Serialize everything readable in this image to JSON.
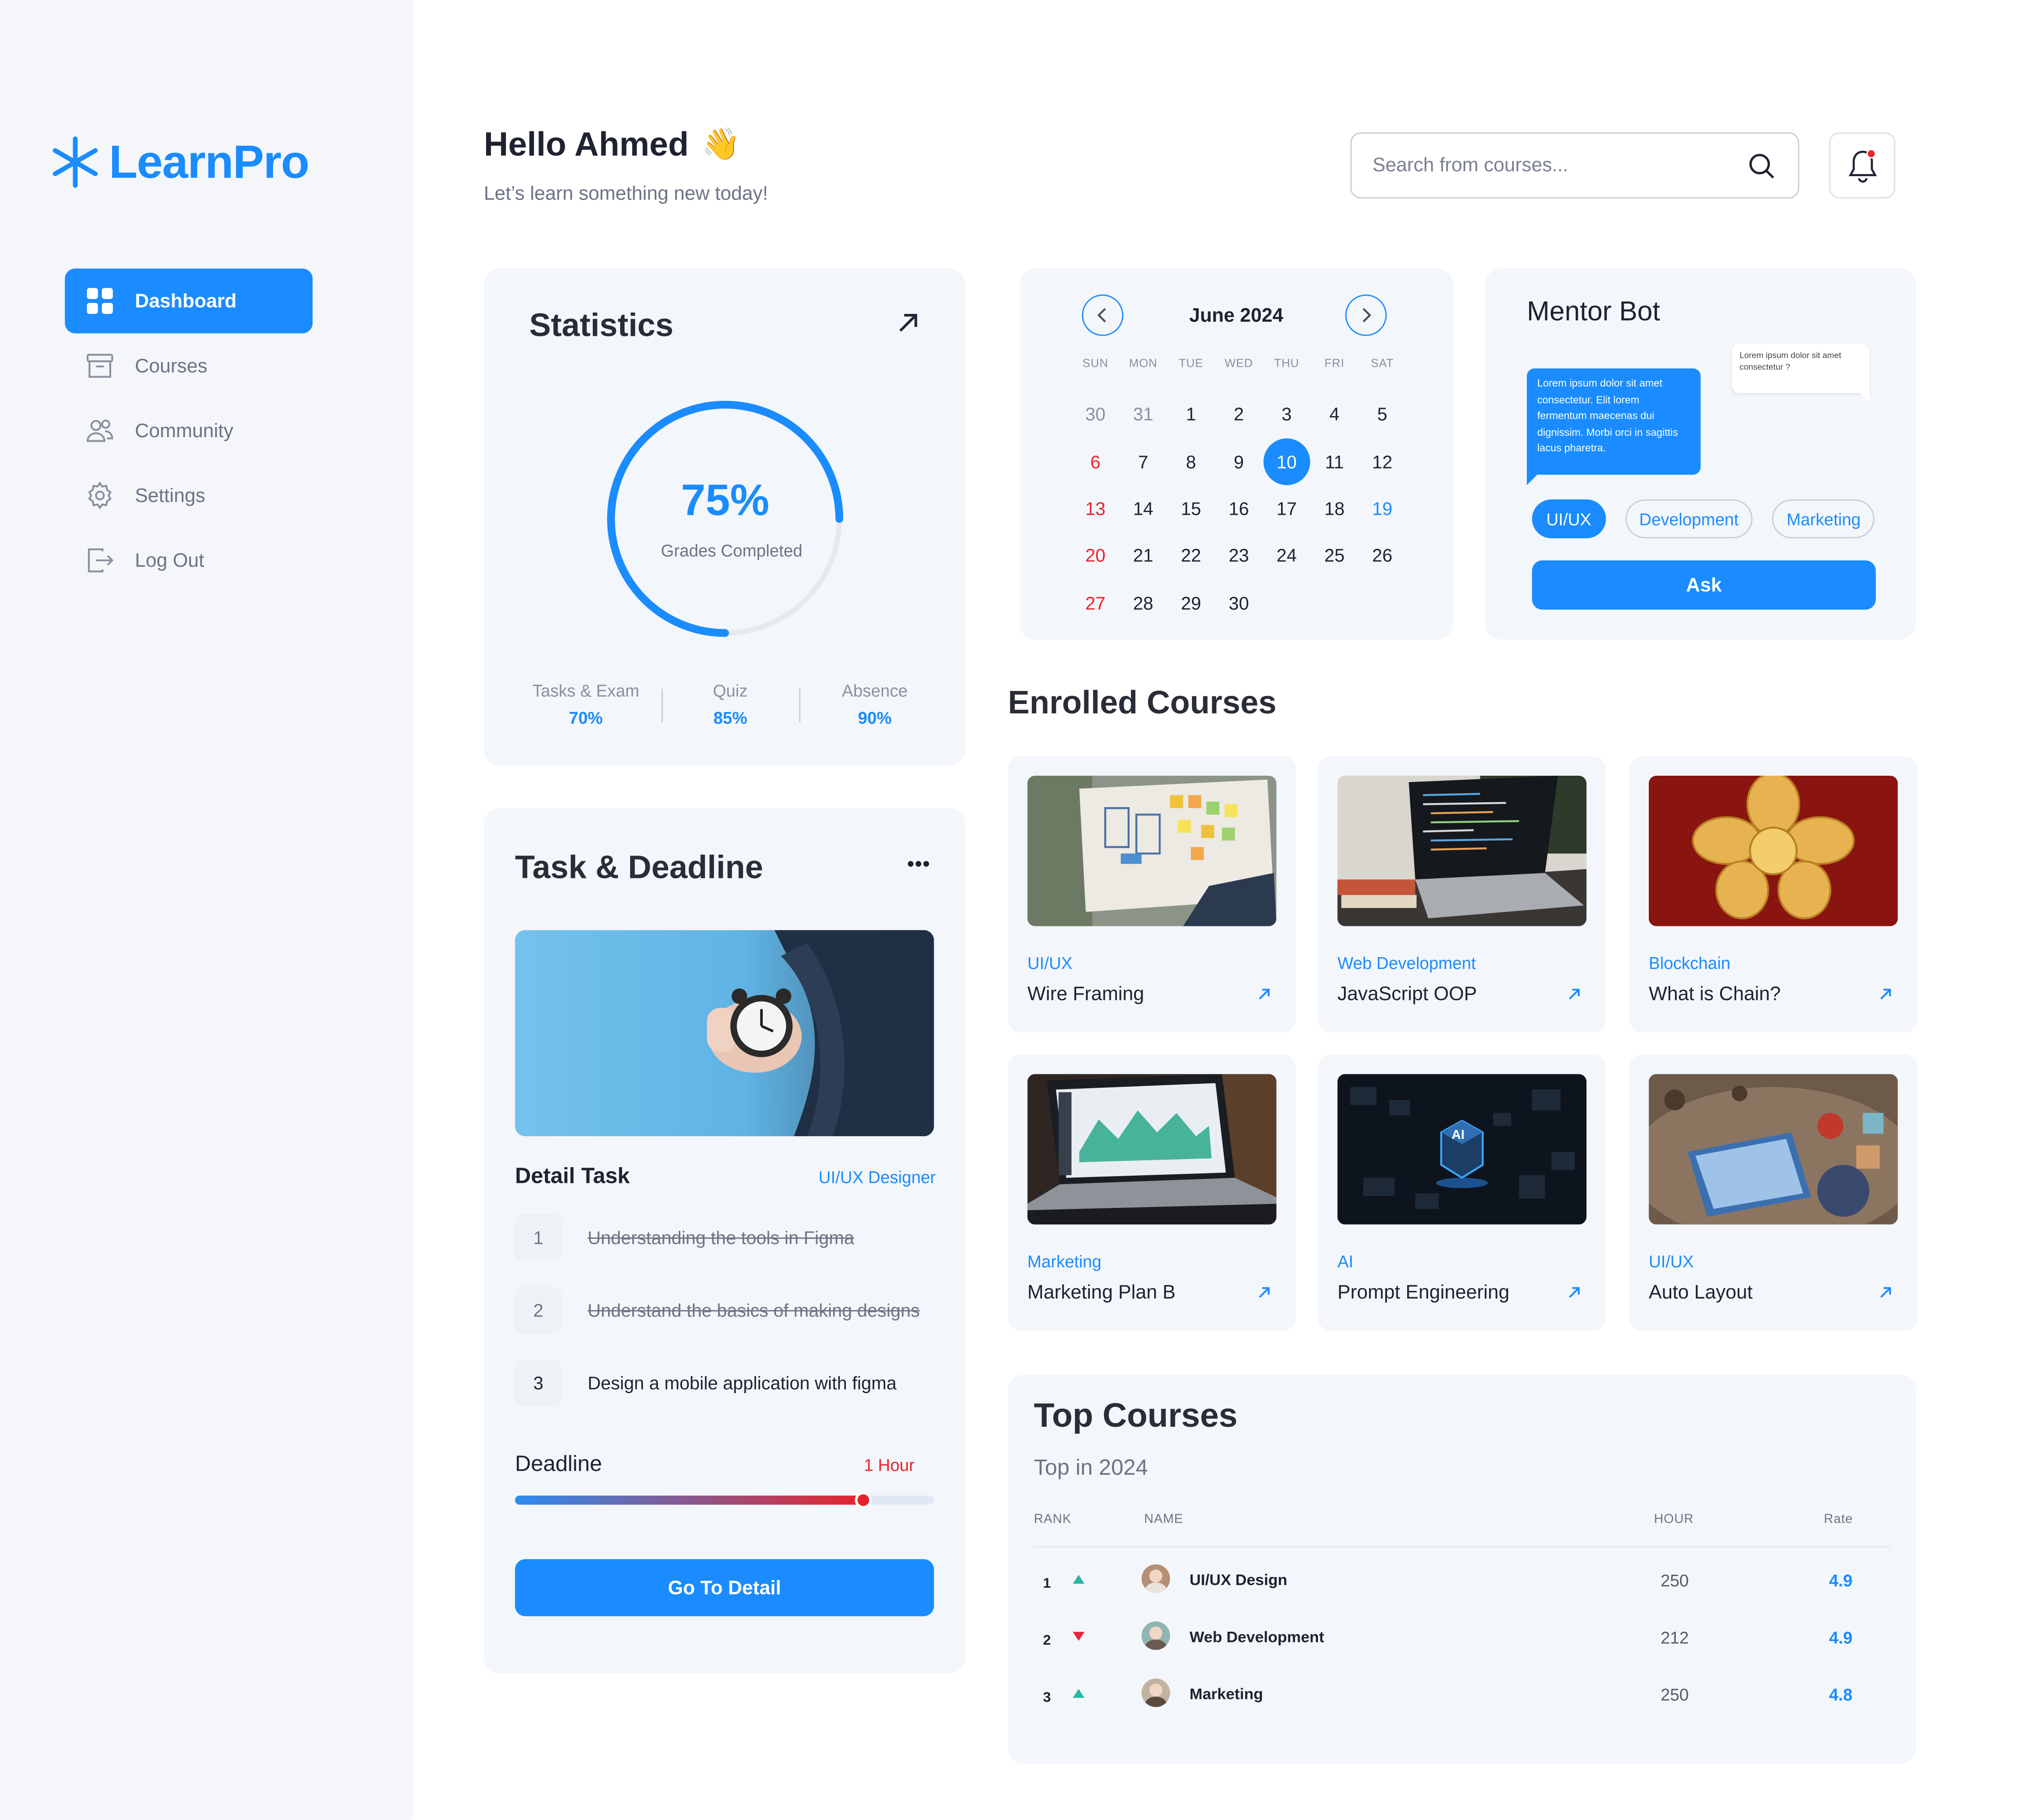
{
  "brand": {
    "name": "LearnPro",
    "color": "#1a8cff"
  },
  "sidebar": {
    "items": [
      {
        "label": "Dashboard",
        "icon": "grid-icon",
        "active": true
      },
      {
        "label": "Courses",
        "icon": "archive-icon",
        "active": false
      },
      {
        "label": "Community",
        "icon": "users-icon",
        "active": false
      },
      {
        "label": "Settings",
        "icon": "gear-icon",
        "active": false
      },
      {
        "label": "Log Out",
        "icon": "logout-icon",
        "active": false
      }
    ]
  },
  "header": {
    "greeting": "Hello Ahmed",
    "wave": "👋",
    "subtitle": "Let’s learn something new today!",
    "search_placeholder": "Search from courses...",
    "search_icon": "search-icon",
    "bell_icon": "bell-icon"
  },
  "statistics": {
    "title": "Statistics",
    "progress_label": "75%",
    "progress_fraction": 0.75,
    "progress_caption": "Grades Completed",
    "metrics": [
      {
        "label": "Tasks & Exam",
        "value": "70%"
      },
      {
        "label": "Quiz",
        "value": "85%"
      },
      {
        "label": "Absence",
        "value": "90%"
      }
    ]
  },
  "calendar": {
    "month": "June 2024",
    "weekdays": [
      "SUN",
      "MON",
      "TUE",
      "WED",
      "THU",
      "FRI",
      "SAT"
    ],
    "days": [
      {
        "d": "30",
        "s": "muted"
      },
      {
        "d": "31",
        "s": "muted"
      },
      {
        "d": "1"
      },
      {
        "d": "2"
      },
      {
        "d": "3"
      },
      {
        "d": "4"
      },
      {
        "d": "5"
      },
      {
        "d": "6",
        "s": "red"
      },
      {
        "d": "7"
      },
      {
        "d": "8"
      },
      {
        "d": "9"
      },
      {
        "d": "10",
        "s": "today"
      },
      {
        "d": "11"
      },
      {
        "d": "12"
      },
      {
        "d": "13",
        "s": "red"
      },
      {
        "d": "14"
      },
      {
        "d": "15"
      },
      {
        "d": "16"
      },
      {
        "d": "17"
      },
      {
        "d": "18"
      },
      {
        "d": "19",
        "s": "blue"
      },
      {
        "d": "20",
        "s": "red"
      },
      {
        "d": "21"
      },
      {
        "d": "22"
      },
      {
        "d": "23"
      },
      {
        "d": "24"
      },
      {
        "d": "25"
      },
      {
        "d": "26"
      },
      {
        "d": "27",
        "s": "red"
      },
      {
        "d": "28"
      },
      {
        "d": "29"
      },
      {
        "d": "30"
      }
    ]
  },
  "mentor_bot": {
    "title": "Mentor Bot",
    "bot_message": "Lorem ipsum dolor sit amet consectetur. Elit lorem fermentum maecenas dui dignissim. Morbi orci in sagittis lacus pharetra.",
    "user_message": "Lorem ipsum dolor sit amet consectetur ?",
    "chips": [
      {
        "label": "UI/UX",
        "selected": true
      },
      {
        "label": "Development",
        "selected": false
      },
      {
        "label": "Marketing",
        "selected": false
      }
    ],
    "ask_label": "Ask"
  },
  "task": {
    "title": "Task & Deadline",
    "detail_title": "Detail Task",
    "role": "UI/UX Designer",
    "items": [
      {
        "n": "1",
        "text": "Understanding the tools in Figma",
        "done": true
      },
      {
        "n": "2",
        "text": "Understand the basics of making designs",
        "done": true
      },
      {
        "n": "3",
        "text": "Design a mobile application with figma",
        "done": false
      }
    ],
    "deadline_label": "Deadline",
    "deadline_value": "1 Hour",
    "deadline_progress": 0.83,
    "button_label": "Go To Detail"
  },
  "enrolled": {
    "title": "Enrolled Courses",
    "courses": [
      {
        "category": "UI/UX",
        "name": "Wire Framing",
        "thumb": "whiteboard"
      },
      {
        "category": "Web Development",
        "name": "JavaScript OOP",
        "thumb": "laptop-code"
      },
      {
        "category": "Blockchain",
        "name": "What is Chain?",
        "thumb": "coins"
      },
      {
        "category": "Marketing",
        "name": "Marketing Plan B",
        "thumb": "laptop-chart"
      },
      {
        "category": "AI",
        "name": "Prompt Engineering",
        "thumb": "ai-chip"
      },
      {
        "category": "UI/UX",
        "name": "Auto Layout",
        "thumb": "desk"
      }
    ]
  },
  "top_courses": {
    "title": "Top Courses",
    "subtitle": "Top in 2024",
    "headers": {
      "rank": "RANK",
      "name": "NAME",
      "hour": "HOUR",
      "rate": "Rate"
    },
    "rows": [
      {
        "rank": "1",
        "trend": "up",
        "name": "UI/UX Design",
        "hour": "250",
        "rate": "4.9"
      },
      {
        "rank": "2",
        "trend": "down",
        "name": "Web Development",
        "hour": "212",
        "rate": "4.9"
      },
      {
        "rank": "3",
        "trend": "up",
        "name": "Marketing",
        "hour": "250",
        "rate": "4.8"
      }
    ],
    "up_color": "#2ab6a6",
    "down_color": "#e8233b"
  }
}
